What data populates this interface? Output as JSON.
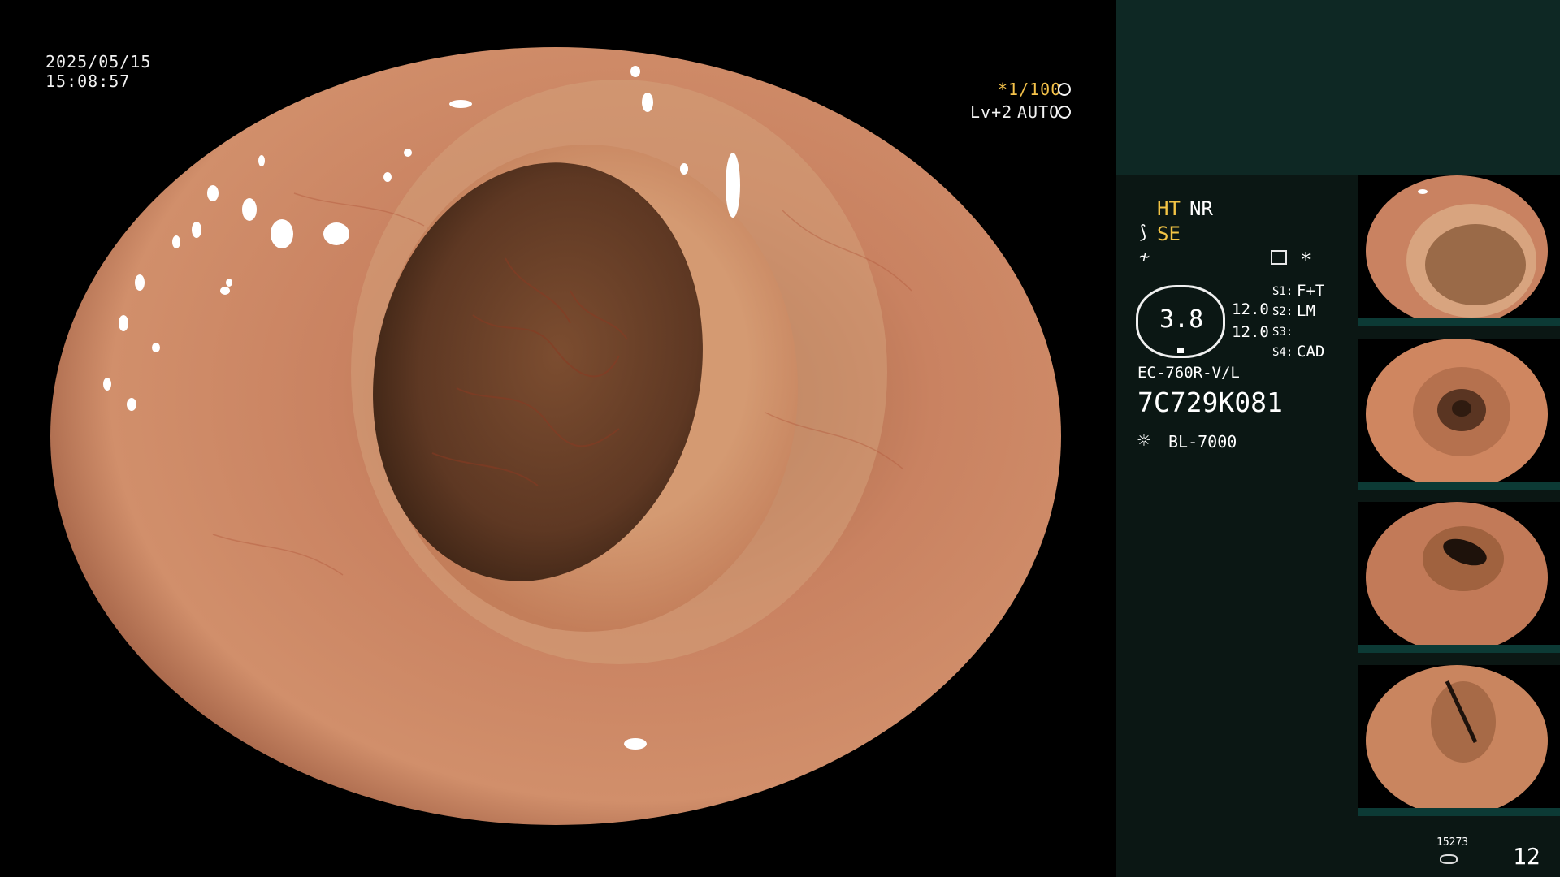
{
  "osd": {
    "date": "2025/05/15",
    "time": "15:08:57",
    "shutter": "*1/100",
    "shutter_icon": "shutter-icon",
    "level": "Lv+2",
    "iris": "AUTO",
    "iris_icon": "iris-icon"
  },
  "panel": {
    "ht": "HT",
    "nr": "NR",
    "se": "SE",
    "se_icon": "scope-adjust-icon",
    "flash_icon": "flash-off-icon",
    "menu_icon": "menu-icon",
    "star": "*",
    "gauge_value": "3.8",
    "val1": "12.0",
    "val2": "12.0",
    "s1_label": "S1:",
    "s1_value": "F+T",
    "s2_label": "S2:",
    "s2_value": "LM",
    "s3_label": "S3:",
    "s3_value": "",
    "s4_label": "S4:",
    "s4_value": "CAD",
    "scope_model": "EC-760R-V/L",
    "serial": "7C729K081",
    "light_source": "BL-7000",
    "light_icon": "light-icon",
    "counter_top": "15273",
    "counter": "12",
    "storage_icon": "storage-icon"
  },
  "colors": {
    "background": "#000000",
    "panel_bg": "#0b1714",
    "panel_top": "#0e2824",
    "accent_yellow": "#f3c445",
    "mucosa": "#c98261",
    "lumen": "#6a4128"
  },
  "thumbnails": [
    {
      "label": "thumbnail-1"
    },
    {
      "label": "thumbnail-2"
    },
    {
      "label": "thumbnail-3"
    },
    {
      "label": "thumbnail-4"
    }
  ]
}
